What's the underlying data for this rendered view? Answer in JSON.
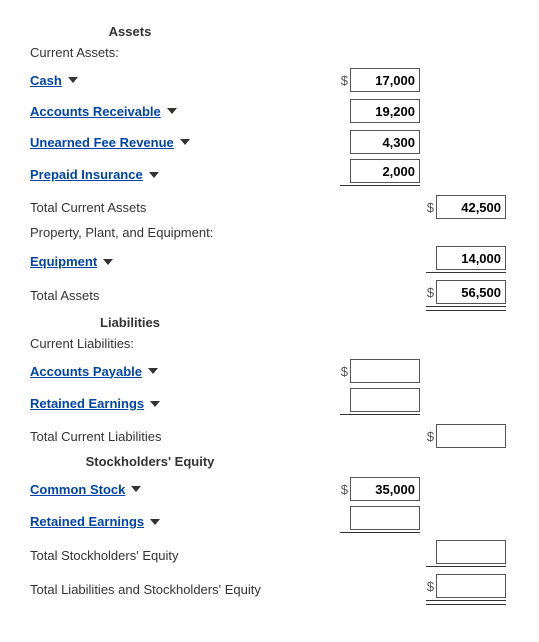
{
  "sections": {
    "assets": "Assets",
    "liabilities": "Liabilities",
    "equity": "Stockholders' Equity"
  },
  "labels": {
    "current_assets": "Current Assets:",
    "cash": "Cash",
    "ar": "Accounts Receivable",
    "unearned_fee": "Unearned Fee Revenue",
    "prepaid_ins": "Prepaid Insurance",
    "total_current_assets": "Total Current Assets",
    "ppe": "Property, Plant, and Equipment:",
    "equipment": "Equipment",
    "total_assets": "Total Assets",
    "current_liabilities": "Current Liabilities:",
    "ap": "Accounts Payable",
    "re1": "Retained Earnings",
    "total_current_liab": "Total Current Liabilities",
    "common_stock": "Common Stock",
    "re2": "Retained Earnings",
    "total_equity": "Total Stockholders' Equity",
    "total_liab_equity": "Total Liabilities and Stockholders' Equity"
  },
  "values": {
    "cash": "17,000",
    "ar": "19,200",
    "unearned_fee": "4,300",
    "prepaid_ins": "2,000",
    "total_current_assets": "42,500",
    "equipment": "14,000",
    "total_assets": "56,500",
    "ap": "",
    "re1": "",
    "total_current_liab": "",
    "common_stock": "35,000",
    "re2": "",
    "total_equity": "",
    "total_liab_equity": ""
  },
  "currency": "$"
}
